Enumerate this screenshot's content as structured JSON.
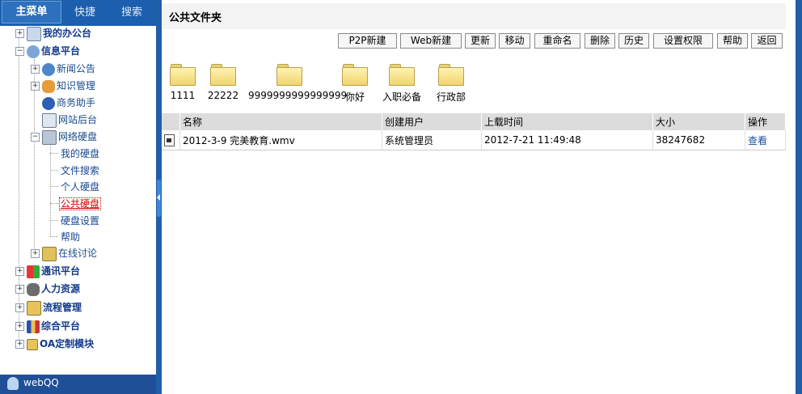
{
  "menu_tabs": {
    "main": "主菜单",
    "shortcut": "快捷",
    "search": "搜索"
  },
  "tree": {
    "office": "我的办公台",
    "info_platform": "信息平台",
    "news": "新闻公告",
    "knowledge": "知识管理",
    "assistant": "商务助手",
    "website": "网站后台",
    "netdisk": "网络硬盘",
    "my_disk": "我的硬盘",
    "file_search": "文件搜索",
    "personal_disk": "个人硬盘",
    "public_disk": "公共硬盘",
    "disk_settings": "硬盘设置",
    "help": "帮助",
    "online_discuss": "在线讨论",
    "comm": "通讯平台",
    "hr": "人力资源",
    "workflow": "流程管理",
    "integrated": "综合平台",
    "oa_custom": "OA定制模块"
  },
  "webqq": "webQQ",
  "main": {
    "title": "公共文件夹",
    "toolbar": [
      "P2P新建",
      "Web新建",
      "更新",
      "移动",
      "重命名",
      "删除",
      "历史",
      "设置权限",
      "帮助",
      "返回"
    ],
    "folders": [
      "1111",
      "22222",
      "9999999999999999",
      "你好",
      "入职必备",
      "行政部"
    ],
    "table": {
      "headers": [
        "名称",
        "创建用户",
        "上载时间",
        "大小",
        "操作"
      ],
      "rows": [
        {
          "name": "2012-3-9 完美教育.wmv",
          "user": "系统管理员",
          "time": "2012-7-21 11:49:48",
          "size": "38247682",
          "action": "查看"
        }
      ]
    }
  },
  "colors": {
    "frame": "#1f5fa8",
    "selected": "#d40000",
    "header_bg": "#dcdcdc"
  }
}
